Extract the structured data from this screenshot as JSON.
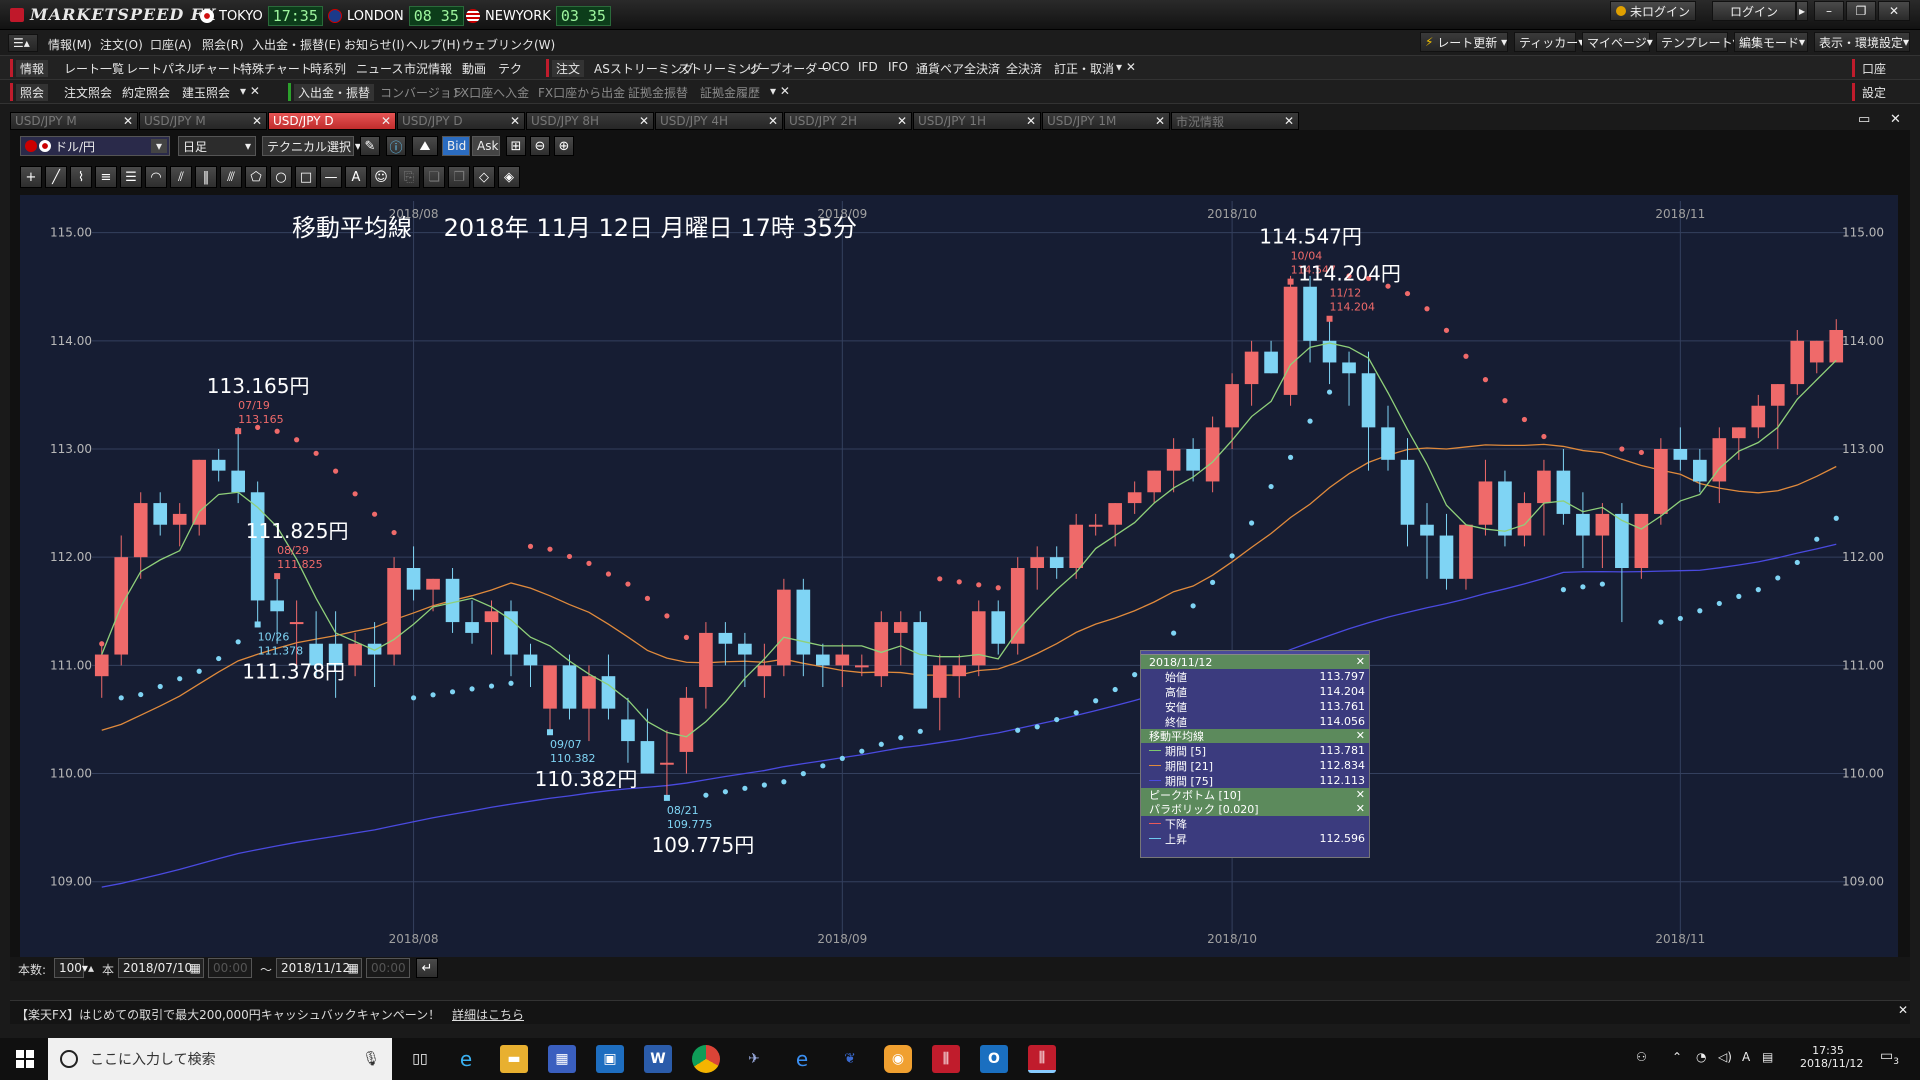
{
  "titlebar": {
    "brand": "MARKETSPEED FX",
    "clocks": [
      {
        "city": "TOKYO",
        "time": "17:35"
      },
      {
        "city": "LONDON",
        "time": "08 35"
      },
      {
        "city": "NEWYORK",
        "time": "03 35"
      }
    ],
    "login_status": "未ログイン",
    "login_button": "ログイン"
  },
  "menubar": {
    "items": [
      "情報(M)",
      "注文(O)",
      "口座(A)",
      "照会(R)",
      "入出金・振替(E)",
      "お知らせ(I)",
      "ヘルプ(H)",
      "ウェブリンク(W)"
    ],
    "right_items": [
      "レート更新",
      "ティッカー",
      "マイページ",
      "テンプレート",
      "編集モード",
      "表示・環境設定"
    ]
  },
  "toolbar1": {
    "group_label": "情報",
    "items": [
      "レート一覧",
      "レートパネル",
      "チャート",
      "特殊チャート",
      "時系列",
      "ニュース",
      "市況情報",
      "動画",
      "テク"
    ],
    "order_label": "注文",
    "order_items": [
      "ASストリーミング",
      "ストリーミング",
      "リーブオーダー",
      "OCO",
      "IFD",
      "IFO",
      "通貨ペア全決済",
      "全決済",
      "訂正・取消"
    ],
    "right_label": "口座"
  },
  "toolbar2": {
    "group_label": "照会",
    "items": [
      "注文照会",
      "約定照会",
      "建玉照会"
    ],
    "transfer_label": "入出金・振替",
    "dim_items": [
      "コンバージョン",
      "FX口座へ入金",
      "FX口座から出金",
      "証拠金振替",
      "証拠金履歴"
    ],
    "right_label": "設定"
  },
  "tabs": [
    {
      "label": "USD/JPY M",
      "active": false
    },
    {
      "label": "USD/JPY M",
      "active": false
    },
    {
      "label": "USD/JPY D",
      "active": true
    },
    {
      "label": "USD/JPY D",
      "active": false
    },
    {
      "label": "USD/JPY 8H",
      "active": false
    },
    {
      "label": "USD/JPY 4H",
      "active": false
    },
    {
      "label": "USD/JPY 2H",
      "active": false
    },
    {
      "label": "USD/JPY 1H",
      "active": false
    },
    {
      "label": "USD/JPY 1M",
      "active": false
    },
    {
      "label": "市況情報",
      "active": false
    }
  ],
  "chart_controls": {
    "pair": "ドル/円",
    "period": "日足",
    "technical": "テクニカル選択",
    "bid": "Bid",
    "ask": "Ask"
  },
  "bottom_controls": {
    "count_label": "本数:",
    "count_value": "100",
    "unit": "本",
    "from_date": "2018/07/10",
    "from_time": "00:00",
    "tilde": "～",
    "to_date": "2018/11/12",
    "to_time": "00:00"
  },
  "ad_text": "【楽天FX】はじめての取引で最大200,000円キャッシュバックキャンペーン！",
  "ad_link": "詳細はこちら",
  "taskbar": {
    "search_placeholder": "ここに入力して検索",
    "time": "17:35",
    "date": "2018/11/12",
    "notification_count": "3"
  },
  "infobox": {
    "date": "2018/11/12",
    "ohlc": [
      {
        "k": "始値",
        "v": "113.797"
      },
      {
        "k": "高値",
        "v": "114.204"
      },
      {
        "k": "安値",
        "v": "113.761"
      },
      {
        "k": "終値",
        "v": "114.056"
      }
    ],
    "ma_title": "移動平均線",
    "ma": [
      {
        "k": "期間 [5]",
        "v": "113.781",
        "color": "#7ec86e"
      },
      {
        "k": "期間 [21]",
        "v": "112.834",
        "color": "#e08a3c"
      },
      {
        "k": "期間 [75]",
        "v": "112.113",
        "color": "#4a4ae0"
      }
    ],
    "peak_title": "ピークボトム [10]",
    "sar_title": "パラボリック [0.020]",
    "sar": [
      {
        "k": "下降",
        "v": "",
        "color": "#e85a5a"
      },
      {
        "k": "上昇",
        "v": "112.596",
        "color": "#6ec8f0"
      }
    ]
  },
  "chart_data": {
    "type": "candlestick",
    "title": "移動平均線　 2018年 11月 12日 月曜日 17時 35分",
    "ylim": [
      108.6,
      115.2
    ],
    "yticks": [
      "109.00",
      "110.00",
      "111.00",
      "112.00",
      "113.00",
      "114.00",
      "115.00"
    ],
    "month_labels": [
      {
        "label": "2018/08",
        "index": 16
      },
      {
        "label": "2018/09",
        "index": 38
      },
      {
        "label": "2018/10",
        "index": 58
      },
      {
        "label": "2018/11",
        "index": 81
      }
    ],
    "candles": [
      [
        110.9,
        111.2,
        110.7,
        111.1
      ],
      [
        111.1,
        112.2,
        111.0,
        112.0
      ],
      [
        112.0,
        112.6,
        111.8,
        112.5
      ],
      [
        112.5,
        112.6,
        112.2,
        112.3
      ],
      [
        112.3,
        112.5,
        112.1,
        112.4
      ],
      [
        112.3,
        112.9,
        112.2,
        112.9
      ],
      [
        112.9,
        113.0,
        112.7,
        112.8
      ],
      [
        112.8,
        113.2,
        112.5,
        112.6
      ],
      [
        112.6,
        112.7,
        111.4,
        111.6
      ],
      [
        111.6,
        111.8,
        111.2,
        111.5
      ],
      [
        111.4,
        111.6,
        111.0,
        111.4
      ],
      [
        111.2,
        111.5,
        110.9,
        111.0
      ],
      [
        111.2,
        111.5,
        110.7,
        111.0
      ],
      [
        111.0,
        111.3,
        110.9,
        111.2
      ],
      [
        111.2,
        111.4,
        110.8,
        111.1
      ],
      [
        111.1,
        112.0,
        111.0,
        111.9
      ],
      [
        111.9,
        112.1,
        111.6,
        111.7
      ],
      [
        111.7,
        111.8,
        111.5,
        111.8
      ],
      [
        111.8,
        111.9,
        111.3,
        111.4
      ],
      [
        111.4,
        111.6,
        111.2,
        111.3
      ],
      [
        111.4,
        111.6,
        111.1,
        111.5
      ],
      [
        111.5,
        111.6,
        110.9,
        111.1
      ],
      [
        111.1,
        111.2,
        110.8,
        111.0
      ],
      [
        110.6,
        111.0,
        110.4,
        111.0
      ],
      [
        111.0,
        111.1,
        110.5,
        110.6
      ],
      [
        110.6,
        111.0,
        110.3,
        110.9
      ],
      [
        110.9,
        111.1,
        110.5,
        110.6
      ],
      [
        110.5,
        110.7,
        110.1,
        110.3
      ],
      [
        110.3,
        110.6,
        110.0,
        110.0
      ],
      [
        110.1,
        110.4,
        109.8,
        110.1
      ],
      [
        110.2,
        110.8,
        110.0,
        110.7
      ],
      [
        110.8,
        111.4,
        110.6,
        111.3
      ],
      [
        111.3,
        111.4,
        111.0,
        111.2
      ],
      [
        111.2,
        111.3,
        110.8,
        111.1
      ],
      [
        110.9,
        111.2,
        110.7,
        111.0
      ],
      [
        111.0,
        111.8,
        110.9,
        111.7
      ],
      [
        111.7,
        111.8,
        110.9,
        111.1
      ],
      [
        111.1,
        111.2,
        110.8,
        111.0
      ],
      [
        111.0,
        111.2,
        110.8,
        111.1
      ],
      [
        111.0,
        111.1,
        110.9,
        111.0
      ],
      [
        110.9,
        111.5,
        110.8,
        111.4
      ],
      [
        111.3,
        111.5,
        111.0,
        111.4
      ],
      [
        111.4,
        111.5,
        110.7,
        110.6
      ],
      [
        110.7,
        111.1,
        110.4,
        111.0
      ],
      [
        110.9,
        111.1,
        110.7,
        111.0
      ],
      [
        111.0,
        111.6,
        110.9,
        111.5
      ],
      [
        111.5,
        111.6,
        111.1,
        111.2
      ],
      [
        111.2,
        112.0,
        111.1,
        111.9
      ],
      [
        111.9,
        112.1,
        111.7,
        112.0
      ],
      [
        112.0,
        112.1,
        111.8,
        111.9
      ],
      [
        111.9,
        112.4,
        111.8,
        112.3
      ],
      [
        112.3,
        112.4,
        112.2,
        112.3
      ],
      [
        112.3,
        112.5,
        112.1,
        112.5
      ],
      [
        112.5,
        112.7,
        112.4,
        112.6
      ],
      [
        112.6,
        112.8,
        112.5,
        112.8
      ],
      [
        112.8,
        113.1,
        112.6,
        113.0
      ],
      [
        113.0,
        113.1,
        112.7,
        112.8
      ],
      [
        112.7,
        113.3,
        112.6,
        113.2
      ],
      [
        113.2,
        113.7,
        113.0,
        113.6
      ],
      [
        113.6,
        114.0,
        113.4,
        113.9
      ],
      [
        113.9,
        114.0,
        113.7,
        113.7
      ],
      [
        113.5,
        114.6,
        113.4,
        114.5
      ],
      [
        114.5,
        114.6,
        113.8,
        114.0
      ],
      [
        114.0,
        114.2,
        113.6,
        113.8
      ],
      [
        113.8,
        113.9,
        113.4,
        113.7
      ],
      [
        113.7,
        113.9,
        112.8,
        113.2
      ],
      [
        113.2,
        113.4,
        112.8,
        112.9
      ],
      [
        112.9,
        113.1,
        112.1,
        112.3
      ],
      [
        112.3,
        112.5,
        111.8,
        112.2
      ],
      [
        112.2,
        112.4,
        111.7,
        111.8
      ],
      [
        111.8,
        112.3,
        111.7,
        112.3
      ],
      [
        112.3,
        112.9,
        112.2,
        112.7
      ],
      [
        112.7,
        112.8,
        112.1,
        112.2
      ],
      [
        112.2,
        112.6,
        112.1,
        112.5
      ],
      [
        112.5,
        112.9,
        112.2,
        112.8
      ],
      [
        112.8,
        113.0,
        112.3,
        112.4
      ],
      [
        112.4,
        112.6,
        111.9,
        112.2
      ],
      [
        112.2,
        112.5,
        111.9,
        112.4
      ],
      [
        112.4,
        112.5,
        111.4,
        111.9
      ],
      [
        111.9,
        112.4,
        111.8,
        112.4
      ],
      [
        112.4,
        113.1,
        112.3,
        113.0
      ],
      [
        113.0,
        113.2,
        112.8,
        112.9
      ],
      [
        112.9,
        113.0,
        112.6,
        112.7
      ],
      [
        112.7,
        113.2,
        112.5,
        113.1
      ],
      [
        113.1,
        113.2,
        112.9,
        113.2
      ],
      [
        113.2,
        113.5,
        113.1,
        113.4
      ],
      [
        113.4,
        113.6,
        113.0,
        113.6
      ],
      [
        113.6,
        114.1,
        113.5,
        114.0
      ],
      [
        113.8,
        114.0,
        113.7,
        114.0
      ],
      [
        113.8,
        114.2,
        113.8,
        114.1
      ]
    ],
    "peaks": [
      {
        "label": "113.165円",
        "date": "07/19",
        "value": "113.165",
        "kind": "high"
      },
      {
        "label": "109.775円",
        "date": "08/21",
        "value": "109.775",
        "kind": "low"
      },
      {
        "label": "111.825円",
        "date": "08/29",
        "value": "111.825",
        "kind": "high"
      },
      {
        "label": "110.382円",
        "date": "09/07",
        "value": "110.382",
        "kind": "low"
      },
      {
        "label": "114.547円",
        "date": "10/04",
        "value": "114.547",
        "kind": "high"
      },
      {
        "label": "111.378円",
        "date": "10/26",
        "value": "111.378",
        "kind": "low"
      },
      {
        "label": "114.204円",
        "date": "11/12",
        "value": "114.204",
        "kind": "high"
      }
    ],
    "grid": true
  }
}
